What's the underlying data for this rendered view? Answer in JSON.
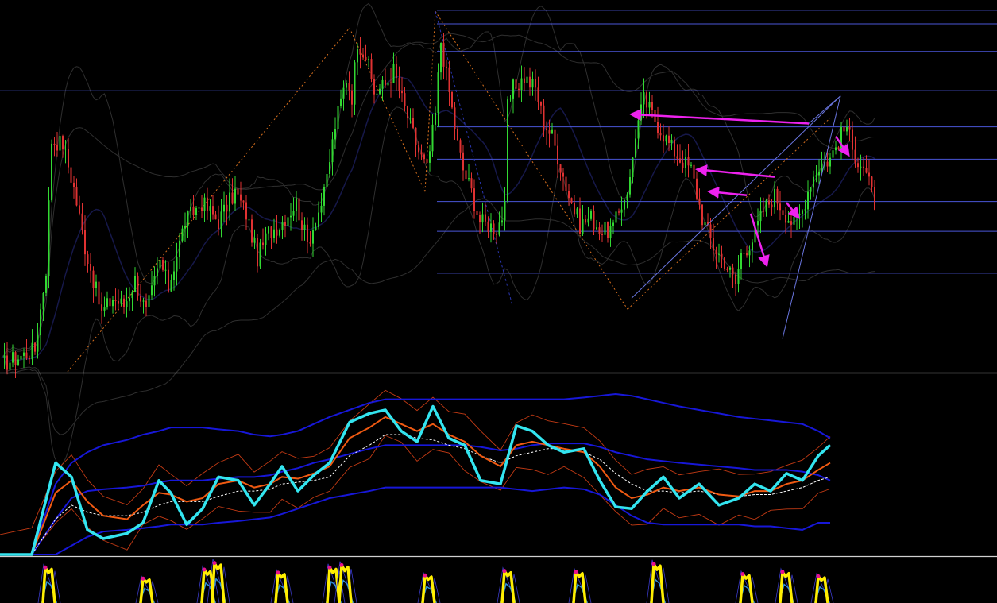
{
  "chart_data": [
    {
      "type": "candlestick",
      "panel": "price",
      "title": "",
      "grid": false,
      "colors": {
        "background": "#000000",
        "bull": "#32d832",
        "bear": "#e03232",
        "fib_line": "#4a56d8",
        "bands": "#2f2f2f",
        "mid_band": "#16184a",
        "zigzag": "#d8701e",
        "channel": "#6a76e0",
        "arrow": "#ee22ee"
      },
      "ylim": [
        0,
        100
      ],
      "xlim": [
        0,
        1255
      ],
      "fib_levels": [
        98.3,
        94.6,
        87.1,
        76.4,
        66.6,
        57.8,
        46.3,
        38.2,
        26.8
      ],
      "horizontal_level": 76.4,
      "zigzag": [
        {
          "x": 85,
          "y": 0
        },
        {
          "x": 440,
          "y": 93.5
        },
        {
          "x": 535,
          "y": 49
        },
        {
          "x": 548,
          "y": 98
        },
        {
          "x": 790,
          "y": 17
        },
        {
          "x": 1045,
          "y": 69
        }
      ],
      "arrows": [
        {
          "from": [
            1018,
            67.5
          ],
          "to": [
            795,
            70
          ]
        },
        {
          "from": [
            975,
            53
          ],
          "to": [
            878,
            55
          ]
        },
        {
          "from": [
            940,
            48
          ],
          "to": [
            893,
            49
          ]
        },
        {
          "from": [
            945,
            43
          ],
          "to": [
            965,
            29
          ]
        },
        {
          "from": [
            990,
            46
          ],
          "to": [
            1005,
            42
          ]
        },
        {
          "from": [
            1052,
            64
          ],
          "to": [
            1068,
            59
          ]
        }
      ],
      "channel_lines": [
        {
          "from": [
            795,
            20
          ],
          "to": [
            1058,
            75
          ]
        },
        {
          "from": [
            985,
            9
          ],
          "to": [
            1058,
            75
          ]
        }
      ],
      "candles": {
        "start_x": 2,
        "spacing": 3.5,
        "anchors": [
          [
            0,
            2
          ],
          [
            12,
            6
          ],
          [
            16,
            28
          ],
          [
            18,
            63
          ],
          [
            22,
            62
          ],
          [
            26,
            50
          ],
          [
            30,
            34
          ],
          [
            36,
            16
          ],
          [
            40,
            20
          ],
          [
            44,
            18
          ],
          [
            48,
            25
          ],
          [
            52,
            16
          ],
          [
            57,
            30
          ],
          [
            60,
            23
          ],
          [
            66,
            41
          ],
          [
            72,
            46
          ],
          [
            78,
            41
          ],
          [
            84,
            49
          ],
          [
            88,
            43
          ],
          [
            92,
            31
          ],
          [
            96,
            38
          ],
          [
            100,
            40
          ],
          [
            106,
            46
          ],
          [
            110,
            35
          ],
          [
            116,
            48
          ],
          [
            120,
            67
          ],
          [
            124,
            80
          ],
          [
            126,
            75
          ],
          [
            128,
            90
          ],
          [
            131,
            86
          ],
          [
            134,
            76
          ],
          [
            138,
            78
          ],
          [
            141,
            82
          ],
          [
            144,
            74
          ],
          [
            150,
            60
          ],
          [
            153,
            55
          ],
          [
            156,
            70
          ],
          [
            158,
            90
          ],
          [
            161,
            76
          ],
          [
            164,
            62
          ],
          [
            166,
            55
          ],
          [
            169,
            49
          ],
          [
            172,
            41
          ],
          [
            175,
            40
          ],
          [
            178,
            39
          ],
          [
            181,
            44
          ],
          [
            182,
            72
          ],
          [
            184,
            77
          ],
          [
            188,
            80
          ],
          [
            192,
            77
          ],
          [
            195,
            68
          ],
          [
            198,
            64
          ],
          [
            204,
            48
          ],
          [
            208,
            40
          ],
          [
            212,
            42
          ],
          [
            216,
            38
          ],
          [
            220,
            39
          ],
          [
            226,
            52
          ],
          [
            228,
            65
          ],
          [
            231,
            74
          ],
          [
            234,
            70
          ],
          [
            237,
            66
          ],
          [
            240,
            62
          ],
          [
            244,
            58
          ],
          [
            248,
            55
          ],
          [
            252,
            42
          ],
          [
            256,
            34
          ],
          [
            260,
            30
          ],
          [
            264,
            24
          ],
          [
            266,
            32
          ],
          [
            270,
            36
          ],
          [
            274,
            44
          ],
          [
            278,
            48
          ],
          [
            282,
            43
          ],
          [
            285,
            40
          ],
          [
            288,
            44
          ],
          [
            291,
            52
          ],
          [
            294,
            56
          ],
          [
            298,
            58
          ],
          [
            301,
            63
          ],
          [
            304,
            67
          ],
          [
            306,
            60
          ],
          [
            310,
            56
          ],
          [
            314,
            46
          ]
        ]
      }
    },
    {
      "type": "line",
      "panel": "oscillator",
      "title": "",
      "ylim": [
        0,
        100
      ],
      "colors": {
        "main": "#33e5f0",
        "signal": "#f05a12",
        "slow": "#ffffff",
        "band": "#1717d8",
        "envelope": "#c23a14"
      },
      "x": [
        0,
        40,
        70,
        90,
        110,
        130,
        160,
        180,
        200,
        215,
        235,
        255,
        275,
        300,
        320,
        340,
        355,
        375,
        395,
        415,
        440,
        465,
        485,
        505,
        525,
        545,
        565,
        585,
        605,
        630,
        650,
        670,
        690,
        710,
        735,
        755,
        775,
        795,
        815,
        835,
        855,
        880,
        905,
        930,
        950,
        970,
        990,
        1010,
        1030,
        1045
      ],
      "series": [
        {
          "values": [
            0,
            0,
            52,
            44,
            14,
            9,
            12,
            18,
            42,
            35,
            17,
            26,
            44,
            42,
            28,
            40,
            50,
            36,
            45,
            52,
            75,
            80,
            82,
            70,
            64,
            84,
            66,
            62,
            42,
            40,
            73,
            70,
            62,
            58,
            60,
            42,
            27,
            26,
            36,
            44,
            32,
            40,
            28,
            32,
            40,
            36,
            46,
            42,
            56,
            62
          ]
        },
        {
          "values": [
            0,
            0,
            35,
            42,
            30,
            22,
            20,
            28,
            35,
            34,
            30,
            32,
            40,
            42,
            38,
            40,
            44,
            43,
            46,
            50,
            66,
            72,
            78,
            74,
            70,
            74,
            68,
            64,
            56,
            50,
            62,
            64,
            62,
            60,
            58,
            50,
            38,
            32,
            34,
            38,
            36,
            38,
            34,
            33,
            36,
            36,
            40,
            42,
            48,
            52
          ]
        },
        {
          "values": [
            0,
            0,
            20,
            28,
            24,
            22,
            22,
            24,
            28,
            30,
            30,
            30,
            33,
            36,
            36,
            37,
            40,
            41,
            42,
            44,
            56,
            62,
            68,
            68,
            66,
            65,
            62,
            60,
            56,
            52,
            56,
            58,
            60,
            60,
            58,
            54,
            46,
            40,
            36,
            36,
            35,
            36,
            34,
            33,
            34,
            34,
            36,
            38,
            42,
            44
          ]
        },
        {
          "values": [
            0,
            0,
            40,
            52,
            58,
            62,
            65,
            68,
            70,
            72,
            72,
            72,
            71,
            70,
            68,
            67,
            68,
            70,
            74,
            78,
            82,
            86,
            88,
            88,
            88,
            88,
            88,
            88,
            88,
            88,
            88,
            88,
            88,
            88,
            89,
            90,
            91,
            90,
            88,
            86,
            84,
            82,
            80,
            78,
            77,
            76,
            75,
            74,
            70,
            66
          ]
        },
        {
          "values": [
            0,
            0,
            20,
            32,
            36,
            37,
            38,
            39,
            41,
            42,
            42,
            42,
            43,
            44,
            44,
            45,
            47,
            49,
            52,
            54,
            57,
            60,
            62,
            62,
            62,
            62,
            62,
            62,
            61,
            59,
            60,
            62,
            63,
            63,
            63,
            61,
            58,
            56,
            54,
            53,
            52,
            51,
            50,
            49,
            48,
            48,
            48,
            47,
            45,
            42
          ]
        },
        {
          "values": [
            0,
            0,
            0,
            5,
            10,
            13,
            14,
            15,
            16,
            17,
            17,
            17,
            18,
            19,
            20,
            21,
            23,
            26,
            29,
            32,
            34,
            36,
            38,
            38,
            38,
            38,
            38,
            38,
            38,
            38,
            37,
            36,
            37,
            38,
            37,
            34,
            28,
            22,
            18,
            17,
            17,
            17,
            17,
            17,
            16,
            16,
            15,
            14,
            18,
            18
          ]
        }
      ]
    },
    {
      "type": "line",
      "panel": "lower-oscillator",
      "title": "",
      "ylim": [
        0,
        100
      ],
      "colors": {
        "main": "#ffee00",
        "highlight": "#e6128c",
        "secondary": "#2f8fd8",
        "envelope": "#3a3ac8"
      },
      "peaks": [
        {
          "x": 62,
          "height": 80
        },
        {
          "x": 185,
          "height": 55
        },
        {
          "x": 262,
          "height": 75
        },
        {
          "x": 275,
          "height": 90
        },
        {
          "x": 355,
          "height": 68
        },
        {
          "x": 420,
          "height": 80
        },
        {
          "x": 435,
          "height": 85
        },
        {
          "x": 540,
          "height": 62
        },
        {
          "x": 640,
          "height": 72
        },
        {
          "x": 730,
          "height": 70
        },
        {
          "x": 828,
          "height": 88
        },
        {
          "x": 940,
          "height": 65
        },
        {
          "x": 990,
          "height": 70
        },
        {
          "x": 1035,
          "height": 60
        }
      ]
    }
  ]
}
